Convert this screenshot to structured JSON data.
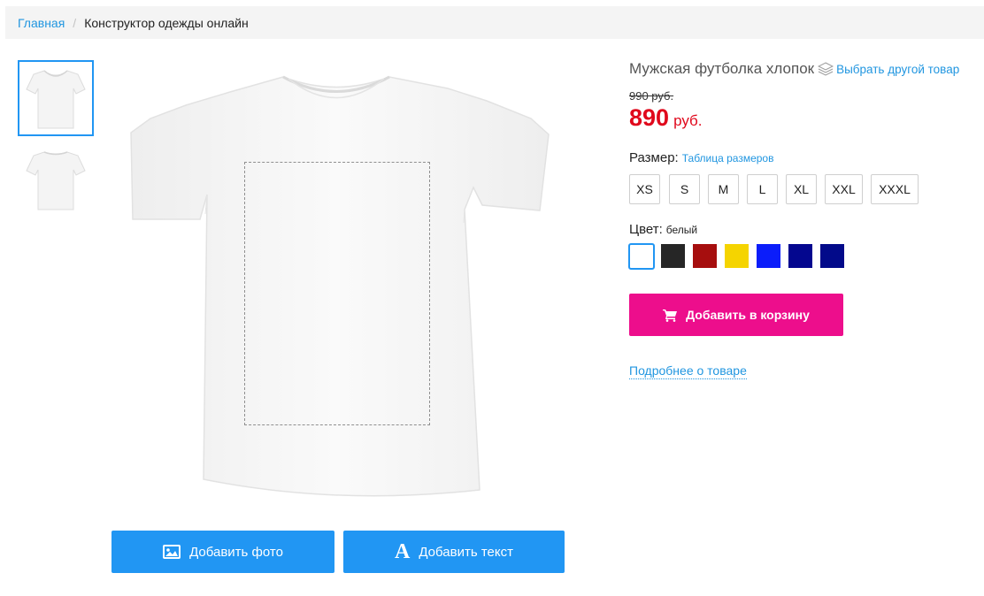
{
  "breadcrumb": {
    "home": "Главная",
    "separator": "/",
    "current": "Конструктор одежды онлайн"
  },
  "gallery": {
    "thumbnails": [
      "front-view",
      "back-view"
    ],
    "selected_index": 0
  },
  "actions": {
    "add_photo": "Добавить фото",
    "add_text": "Добавить текст"
  },
  "product": {
    "title": "Мужская футболка хлопок",
    "change_link": "Выбрать другой товар",
    "old_price": "990 руб.",
    "price": "890",
    "currency": "руб."
  },
  "size": {
    "label": "Размер:",
    "table_link": "Таблица размеров",
    "options": [
      "XS",
      "S",
      "M",
      "L",
      "XL",
      "XXL",
      "XXXL"
    ]
  },
  "color": {
    "label": "Цвет:",
    "selected_name": "белый",
    "selected_index": 0,
    "swatches": [
      "#ffffff",
      "#262626",
      "#a60e0e",
      "#f5d400",
      "#0b1dfa",
      "#04078f",
      "#020a8a"
    ]
  },
  "cart": {
    "label": "Добавить в корзину",
    "icon": "cart-icon"
  },
  "more_link": "Подробнее о товаре",
  "colors": {
    "accent_blue": "#2196f3",
    "cart_pink": "#ed0e8c",
    "price_red": "#e0081c"
  }
}
